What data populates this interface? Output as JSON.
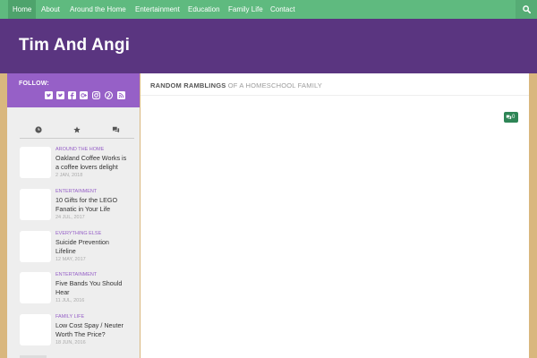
{
  "nav": {
    "items": [
      {
        "label": "Home"
      },
      {
        "label": "About"
      },
      {
        "label": "Around the Home"
      },
      {
        "label": "Entertainment"
      },
      {
        "label": "Education"
      },
      {
        "label": "Family Life"
      },
      {
        "label": "Contact"
      }
    ],
    "search_icon": "search-icon"
  },
  "header": {
    "title": "Tim And Angi"
  },
  "sidebar": {
    "follow_label": "FOLLOW:",
    "social_icons": [
      "twitter-icon",
      "twitter-icon",
      "facebook-icon",
      "google-plus-icon",
      "instagram-icon",
      "pinterest-icon",
      "rss-icon"
    ],
    "tabs": [
      "recent-clock-icon",
      "popular-star-icon",
      "comments-icon"
    ],
    "posts": [
      {
        "category": "AROUND THE HOME",
        "title": "Oakland Coffee Works is a coffee lovers delight",
        "date": "2 JAN, 2018"
      },
      {
        "category": "ENTERTAINMENT",
        "title": "10 Gifts for the LEGO Fanatic in Your Life",
        "date": "24 JUL, 2017"
      },
      {
        "category": "EVERYTHING ELSE",
        "title": "Suicide Prevention Lifeline",
        "date": "12 MAY, 2017"
      },
      {
        "category": "ENTERTAINMENT",
        "title": "Five Bands You Should Hear",
        "date": "11 JUL, 2016"
      },
      {
        "category": "FAMILY LIFE",
        "title": "Low Cost Spay / Neuter Worth The Price?",
        "date": "18 JUN, 2016"
      }
    ]
  },
  "main": {
    "tagline_strong": "RANDOM RAMBLINGS",
    "tagline_sub": "OF A HOMESCHOOL FAMILY",
    "comment_count": "0"
  },
  "colors": {
    "nav_green": "#5fba7f",
    "header_purple": "#5a3580",
    "follow_purple": "#9660c7",
    "page_tan": "#d9b77e",
    "badge_green": "#2e8556"
  }
}
